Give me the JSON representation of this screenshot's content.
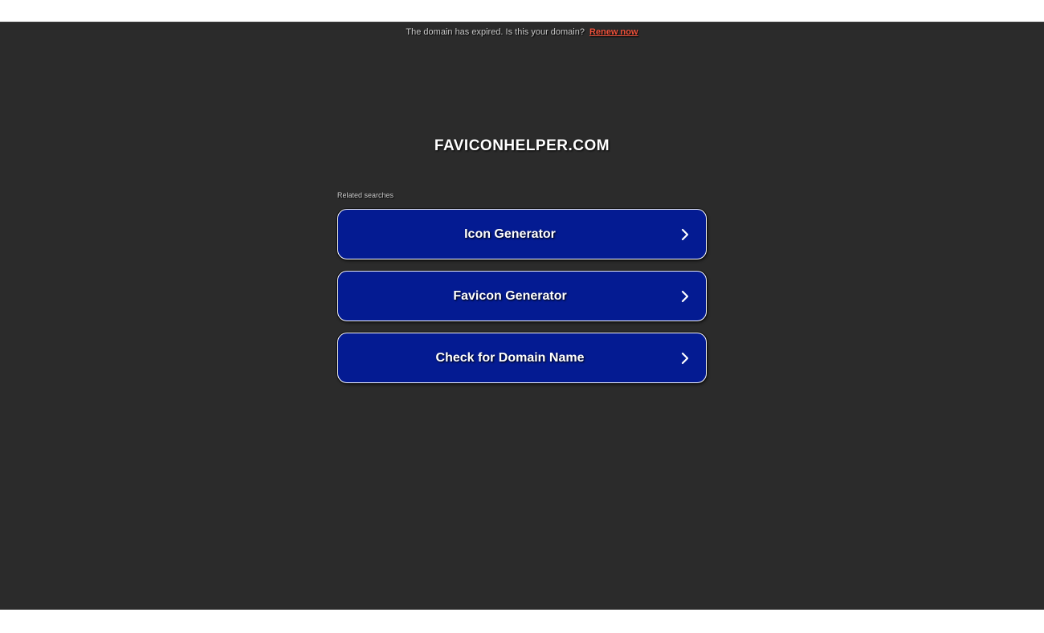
{
  "notice": {
    "text": "The domain has expired. Is this your domain?",
    "link_label": "Renew now"
  },
  "domain": "FAVICONHELPER.COM",
  "related": {
    "label": "Related searches",
    "items": [
      {
        "label": "Icon Generator"
      },
      {
        "label": "Favicon Generator"
      },
      {
        "label": "Check for Domain Name"
      }
    ]
  },
  "colors": {
    "background": "#2b2b2b",
    "button": "#041b92",
    "link": "#f0523b"
  },
  "icons": {
    "button_arrow": "chevron-right-icon"
  }
}
